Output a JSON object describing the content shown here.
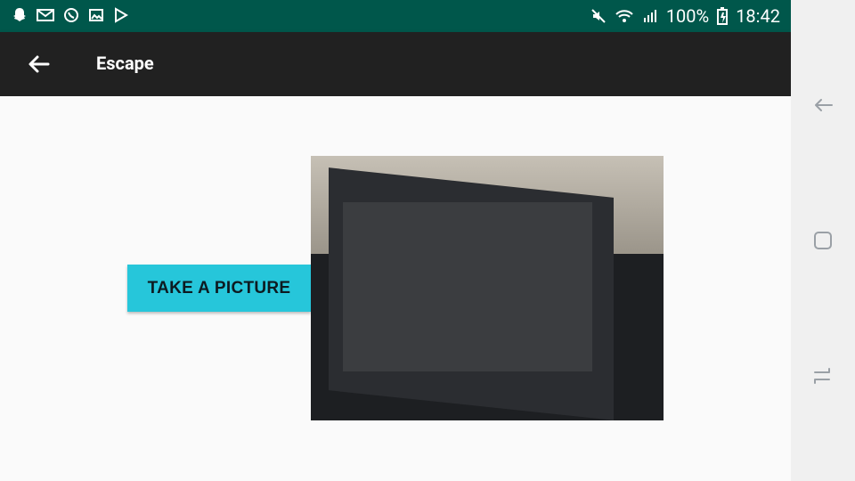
{
  "status_bar": {
    "battery": "100%",
    "time": "18:42"
  },
  "app_bar": {
    "title": "Escape"
  },
  "content": {
    "take_picture_label": "TAKE A PICTURE"
  }
}
